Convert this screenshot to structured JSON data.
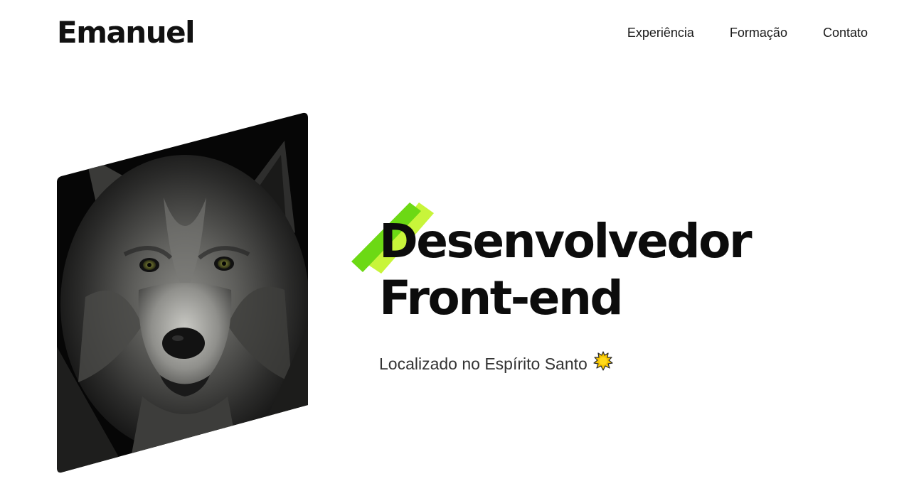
{
  "header": {
    "brand": "Emanuel",
    "nav": [
      {
        "label": "Experiência"
      },
      {
        "label": "Formação"
      },
      {
        "label": "Contato"
      }
    ]
  },
  "hero": {
    "image_subject": "wolf portrait photo",
    "headline_line1": "Desenvolvedor",
    "headline_line2": "Front-end",
    "location_text": "Localizado no Espírito Santo",
    "location_icon": "sun-icon"
  },
  "colors": {
    "text": "#0c0c0c",
    "accent_green": "#6cd914",
    "accent_lime": "#c8f53a",
    "photo_dark": "#0a0a0a"
  }
}
